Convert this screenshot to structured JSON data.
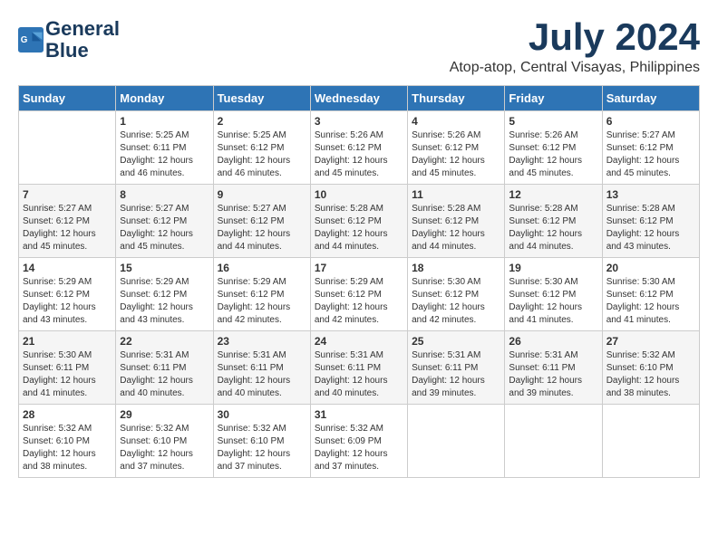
{
  "header": {
    "logo_line1": "General",
    "logo_line2": "Blue",
    "month": "July 2024",
    "location": "Atop-atop, Central Visayas, Philippines"
  },
  "columns": [
    "Sunday",
    "Monday",
    "Tuesday",
    "Wednesday",
    "Thursday",
    "Friday",
    "Saturday"
  ],
  "weeks": [
    [
      {
        "day": "",
        "info": ""
      },
      {
        "day": "1",
        "info": "Sunrise: 5:25 AM\nSunset: 6:11 PM\nDaylight: 12 hours\nand 46 minutes."
      },
      {
        "day": "2",
        "info": "Sunrise: 5:25 AM\nSunset: 6:12 PM\nDaylight: 12 hours\nand 46 minutes."
      },
      {
        "day": "3",
        "info": "Sunrise: 5:26 AM\nSunset: 6:12 PM\nDaylight: 12 hours\nand 45 minutes."
      },
      {
        "day": "4",
        "info": "Sunrise: 5:26 AM\nSunset: 6:12 PM\nDaylight: 12 hours\nand 45 minutes."
      },
      {
        "day": "5",
        "info": "Sunrise: 5:26 AM\nSunset: 6:12 PM\nDaylight: 12 hours\nand 45 minutes."
      },
      {
        "day": "6",
        "info": "Sunrise: 5:27 AM\nSunset: 6:12 PM\nDaylight: 12 hours\nand 45 minutes."
      }
    ],
    [
      {
        "day": "7",
        "info": "Sunrise: 5:27 AM\nSunset: 6:12 PM\nDaylight: 12 hours\nand 45 minutes."
      },
      {
        "day": "8",
        "info": "Sunrise: 5:27 AM\nSunset: 6:12 PM\nDaylight: 12 hours\nand 45 minutes."
      },
      {
        "day": "9",
        "info": "Sunrise: 5:27 AM\nSunset: 6:12 PM\nDaylight: 12 hours\nand 44 minutes."
      },
      {
        "day": "10",
        "info": "Sunrise: 5:28 AM\nSunset: 6:12 PM\nDaylight: 12 hours\nand 44 minutes."
      },
      {
        "day": "11",
        "info": "Sunrise: 5:28 AM\nSunset: 6:12 PM\nDaylight: 12 hours\nand 44 minutes."
      },
      {
        "day": "12",
        "info": "Sunrise: 5:28 AM\nSunset: 6:12 PM\nDaylight: 12 hours\nand 44 minutes."
      },
      {
        "day": "13",
        "info": "Sunrise: 5:28 AM\nSunset: 6:12 PM\nDaylight: 12 hours\nand 43 minutes."
      }
    ],
    [
      {
        "day": "14",
        "info": "Sunrise: 5:29 AM\nSunset: 6:12 PM\nDaylight: 12 hours\nand 43 minutes."
      },
      {
        "day": "15",
        "info": "Sunrise: 5:29 AM\nSunset: 6:12 PM\nDaylight: 12 hours\nand 43 minutes."
      },
      {
        "day": "16",
        "info": "Sunrise: 5:29 AM\nSunset: 6:12 PM\nDaylight: 12 hours\nand 42 minutes."
      },
      {
        "day": "17",
        "info": "Sunrise: 5:29 AM\nSunset: 6:12 PM\nDaylight: 12 hours\nand 42 minutes."
      },
      {
        "day": "18",
        "info": "Sunrise: 5:30 AM\nSunset: 6:12 PM\nDaylight: 12 hours\nand 42 minutes."
      },
      {
        "day": "19",
        "info": "Sunrise: 5:30 AM\nSunset: 6:12 PM\nDaylight: 12 hours\nand 41 minutes."
      },
      {
        "day": "20",
        "info": "Sunrise: 5:30 AM\nSunset: 6:12 PM\nDaylight: 12 hours\nand 41 minutes."
      }
    ],
    [
      {
        "day": "21",
        "info": "Sunrise: 5:30 AM\nSunset: 6:11 PM\nDaylight: 12 hours\nand 41 minutes."
      },
      {
        "day": "22",
        "info": "Sunrise: 5:31 AM\nSunset: 6:11 PM\nDaylight: 12 hours\nand 40 minutes."
      },
      {
        "day": "23",
        "info": "Sunrise: 5:31 AM\nSunset: 6:11 PM\nDaylight: 12 hours\nand 40 minutes."
      },
      {
        "day": "24",
        "info": "Sunrise: 5:31 AM\nSunset: 6:11 PM\nDaylight: 12 hours\nand 40 minutes."
      },
      {
        "day": "25",
        "info": "Sunrise: 5:31 AM\nSunset: 6:11 PM\nDaylight: 12 hours\nand 39 minutes."
      },
      {
        "day": "26",
        "info": "Sunrise: 5:31 AM\nSunset: 6:11 PM\nDaylight: 12 hours\nand 39 minutes."
      },
      {
        "day": "27",
        "info": "Sunrise: 5:32 AM\nSunset: 6:10 PM\nDaylight: 12 hours\nand 38 minutes."
      }
    ],
    [
      {
        "day": "28",
        "info": "Sunrise: 5:32 AM\nSunset: 6:10 PM\nDaylight: 12 hours\nand 38 minutes."
      },
      {
        "day": "29",
        "info": "Sunrise: 5:32 AM\nSunset: 6:10 PM\nDaylight: 12 hours\nand 37 minutes."
      },
      {
        "day": "30",
        "info": "Sunrise: 5:32 AM\nSunset: 6:10 PM\nDaylight: 12 hours\nand 37 minutes."
      },
      {
        "day": "31",
        "info": "Sunrise: 5:32 AM\nSunset: 6:09 PM\nDaylight: 12 hours\nand 37 minutes."
      },
      {
        "day": "",
        "info": ""
      },
      {
        "day": "",
        "info": ""
      },
      {
        "day": "",
        "info": ""
      }
    ]
  ]
}
